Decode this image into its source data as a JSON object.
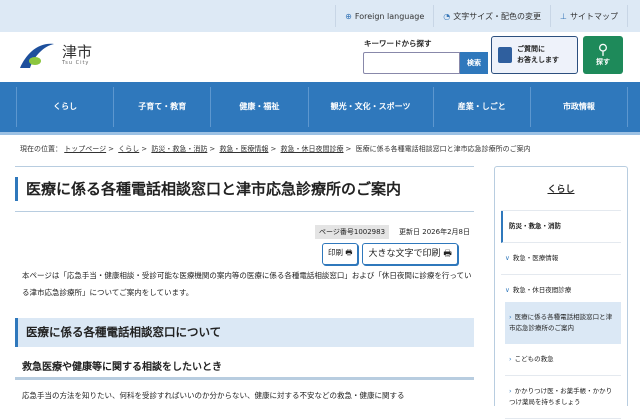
{
  "top_links": [
    {
      "icon": "globe-icon",
      "label": "Foreign language"
    },
    {
      "icon": "text-size-icon",
      "label": "文字サイズ・配色の変更"
    },
    {
      "icon": "sitemap-icon",
      "label": "サイトマップ"
    }
  ],
  "logo": {
    "name": "津市",
    "sub": "Tsu City"
  },
  "search": {
    "label": "キーワードから探す",
    "value": "",
    "button": "検索"
  },
  "qa_button": {
    "line1": "ご質問に",
    "line2": "お答えします"
  },
  "find_button": "探す",
  "nav": [
    "くらし",
    "子育て・教育",
    "健康・福祉",
    "観光・文化・スポーツ",
    "産業・しごと",
    "市政情報"
  ],
  "breadcrumb": {
    "label": "現在の位置：",
    "links": [
      "トップページ",
      "くらし",
      "防災・救急・消防",
      "救急・医療情報",
      "救急・休日夜間診療"
    ],
    "current": "医療に係る各種電話相談窓口と津市応急診療所のご案内"
  },
  "page_title": "医療に係る各種電話相談窓口と津市応急診療所のご案内",
  "page_number": "ページ番号1002983",
  "updated": "更新日 2026年2月8日",
  "print": "印刷",
  "print_large": "大きな文字で印刷",
  "intro": "本ページは「応急手当・健康相談・受診可能な医療機関の案内等の医療に係る各種電話相談窓口」および「休日夜間に診療を行っている津市応急診療所」についてご案内をしています。",
  "section_heading": "医療に係る各種電話相談窓口について",
  "subheading": "救急医療や健康等に関する相談をしたいとき",
  "body_text": "応急手当の方法を知りたい、何科を受診すればいいのか分からない、健康に対する不安などの救急・健康に関する",
  "sidebar": {
    "title": "くらし",
    "items": [
      {
        "label": "防災・救急・消防",
        "chev": ""
      },
      {
        "label": "救急・医療情報",
        "chev": "∨"
      },
      {
        "label": "救急・休日夜間診療",
        "chev": "∨"
      },
      {
        "label": "医療に係る各種電話相談窓口と津市応急診療所のご案内",
        "chev": "›"
      },
      {
        "label": "こどもの救急",
        "chev": "›"
      },
      {
        "label": "かかりつけ医・お薬手帳・かかりつけ薬局を持ちましょう",
        "chev": "›"
      }
    ]
  }
}
